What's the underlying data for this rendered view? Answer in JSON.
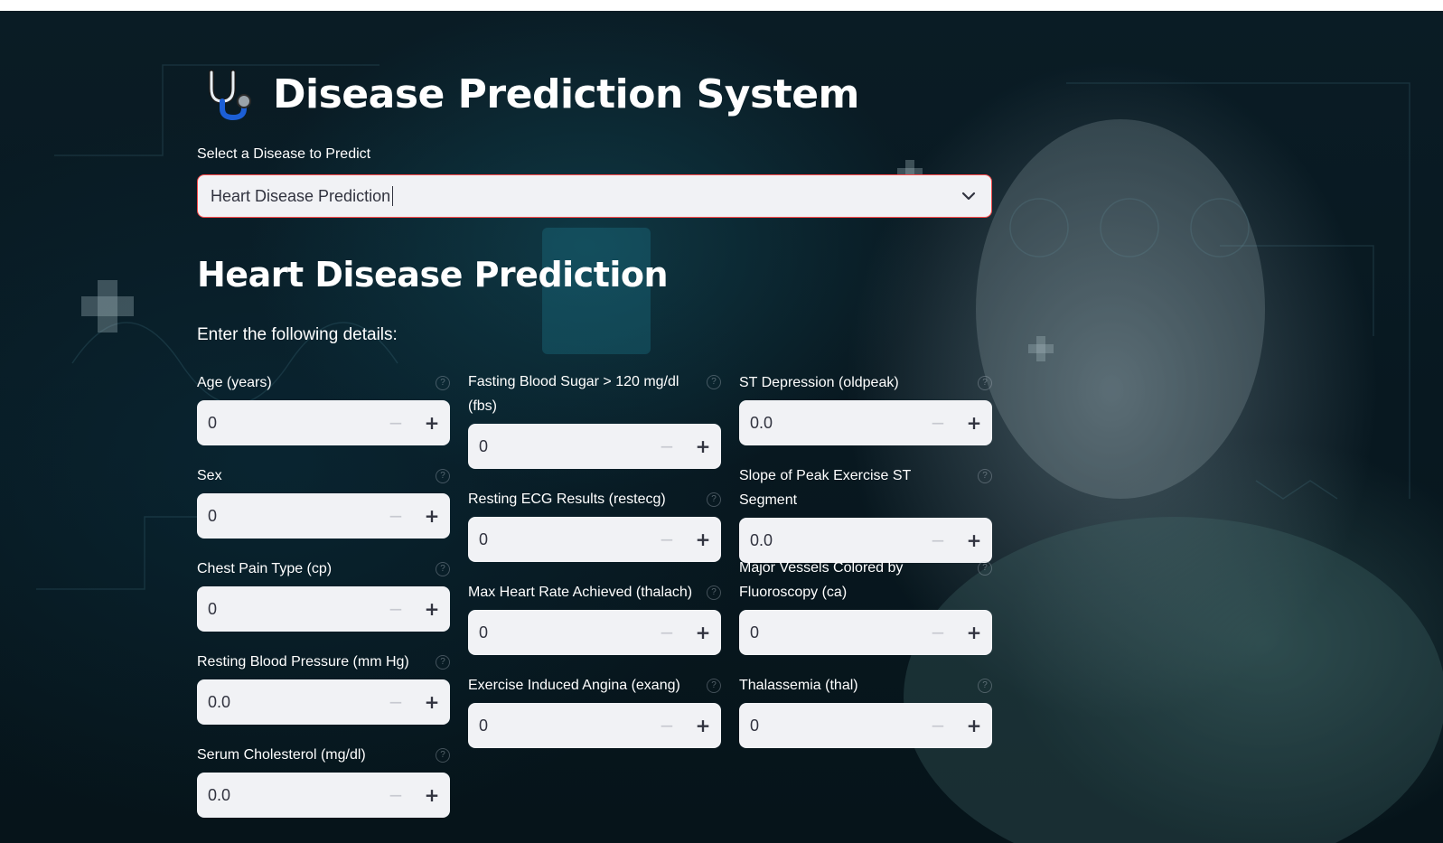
{
  "app": {
    "title": "Disease Prediction System",
    "logo_icon": "stethoscope-icon"
  },
  "selector": {
    "label": "Select a Disease to Predict",
    "value": "Heart Disease Prediction",
    "accent": "#ff4b4b"
  },
  "section": {
    "title": "Heart Disease Prediction",
    "subtitle": "Enter the following details:"
  },
  "fields": {
    "age": {
      "label": "Age (years)",
      "value": "0"
    },
    "sex": {
      "label": "Sex",
      "value": "0"
    },
    "cp": {
      "label": "Chest Pain Type (cp)",
      "value": "0"
    },
    "trestbps": {
      "label": "Resting Blood Pressure (mm Hg)",
      "value": "0.0"
    },
    "chol": {
      "label": "Serum Cholesterol (mg/dl)",
      "value": "0.0"
    },
    "fbs": {
      "label": "Fasting Blood Sugar > 120 mg/dl (fbs)",
      "value": "0"
    },
    "restecg": {
      "label": "Resting ECG Results (restecg)",
      "value": "0"
    },
    "thalach": {
      "label": "Max Heart Rate Achieved (thalach)",
      "value": "0"
    },
    "exang": {
      "label": "Exercise Induced Angina (exang)",
      "value": "0"
    },
    "oldpeak": {
      "label": "ST Depression (oldpeak)",
      "value": "0.0"
    },
    "slope": {
      "label": "Slope of Peak Exercise ST Segment",
      "value": "0.0"
    },
    "ca": {
      "label": "Major Vessels Colored by Fluoroscopy (ca)",
      "value": "0"
    },
    "thal": {
      "label": "Thalassemia (thal)",
      "value": "0"
    }
  },
  "stepper": {
    "minus": "−",
    "plus": "+",
    "help": "?"
  }
}
